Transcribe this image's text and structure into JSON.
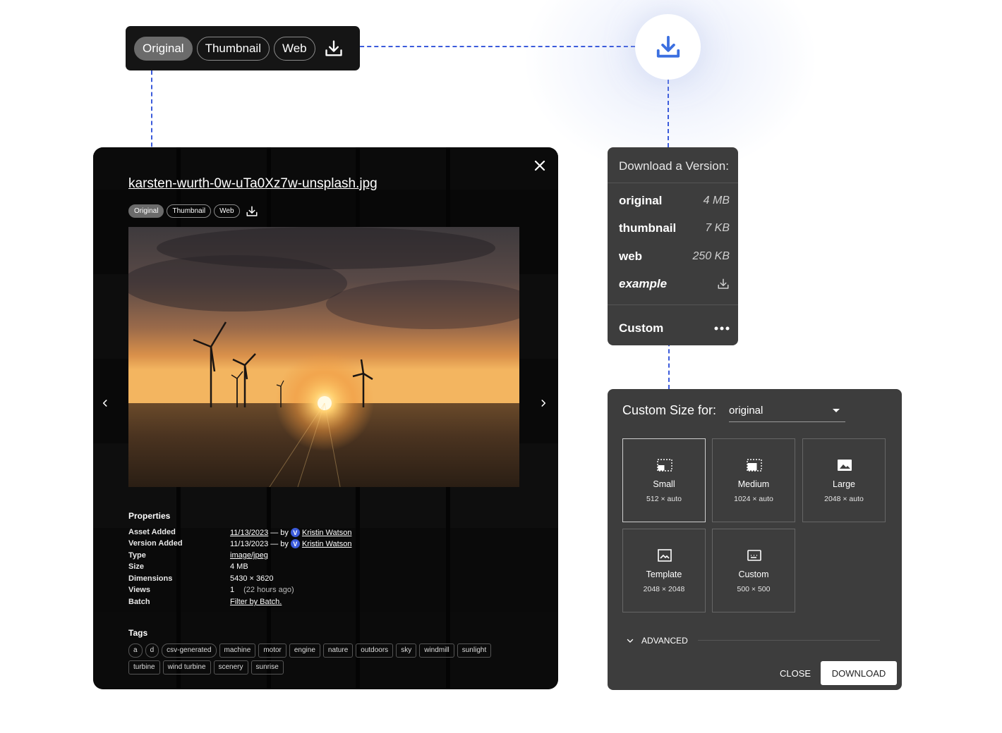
{
  "version_bar": {
    "items": [
      "Original",
      "Thumbnail",
      "Web"
    ],
    "active": "Original"
  },
  "modal": {
    "filename": "karsten-wurth-0w-uTa0Xz7w-unsplash.jpg",
    "version_pills": [
      "Original",
      "Thumbnail",
      "Web"
    ],
    "properties_title": "Properties",
    "properties": [
      {
        "key": "Asset Added",
        "value": "11/13/2023",
        "by": "— by",
        "user": "Kristin Watson",
        "badge": "V"
      },
      {
        "key": "Version Added",
        "value": "11/13/2023",
        "by": "— by",
        "user": "Kristin Watson",
        "badge": "V"
      },
      {
        "key": "Type",
        "value": "image/jpeg"
      },
      {
        "key": "Size",
        "value": "4 MB"
      },
      {
        "key": "Dimensions",
        "value": "5430 × 3620"
      },
      {
        "key": "Views",
        "value": "1",
        "extra": "(22 hours ago)"
      },
      {
        "key": "Batch",
        "value": "Filter by Batch."
      }
    ],
    "tags_title": "Tags",
    "tags": [
      "a",
      "d",
      "csv-generated",
      "machine",
      "motor",
      "engine",
      "nature",
      "outdoors",
      "sky",
      "windmill",
      "sunlight",
      "turbine",
      "wind turbine",
      "scenery",
      "sunrise"
    ]
  },
  "download_panel": {
    "title": "Download a Version:",
    "versions": [
      {
        "name": "original",
        "size": "4 MB"
      },
      {
        "name": "thumbnail",
        "size": "7 KB"
      },
      {
        "name": "web",
        "size": "250 KB"
      }
    ],
    "example_label": "example",
    "custom_label": "Custom"
  },
  "custom_size": {
    "title": "Custom Size for:",
    "selected": "original",
    "options": [
      {
        "label": "Small",
        "dims": "512 × auto"
      },
      {
        "label": "Medium",
        "dims": "1024 × auto"
      },
      {
        "label": "Large",
        "dims": "2048 × auto"
      },
      {
        "label": "Template",
        "dims": "2048 × 2048"
      },
      {
        "label": "Custom",
        "dims": "500 × 500"
      }
    ],
    "advanced_label": "ADVANCED",
    "close_label": "CLOSE",
    "download_label": "DOWNLOAD"
  }
}
